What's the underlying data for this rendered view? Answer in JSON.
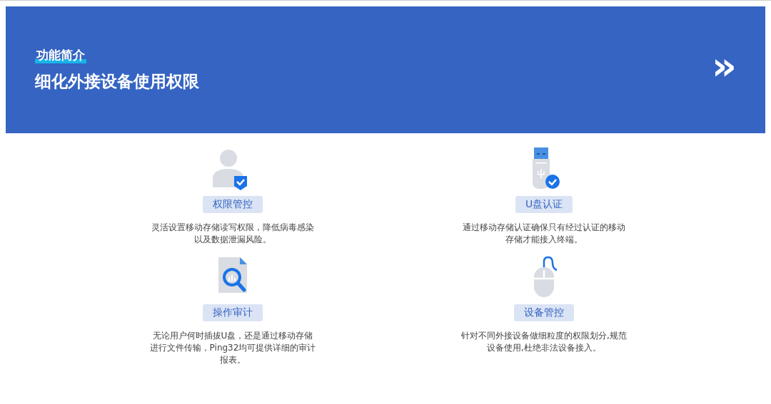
{
  "banner": {
    "eyebrow": "功能简介",
    "title": "细化外接设备使用权限",
    "arrow": "»"
  },
  "features": [
    {
      "kind": "user-shield",
      "label": "权限管控",
      "description": "灵活设置移动存储读写权限，降低病毒感染以及数据泄漏风险。"
    },
    {
      "kind": "usb",
      "label": "U盘认证",
      "description": "通过移动存储认证确保只有经过认证的移动存储才能接入终端。"
    },
    {
      "kind": "document-search",
      "label": "操作审计",
      "description": "无论用户何时插拔U盘，还是通过移动存储进行文件传输，Ping32均可提供详细的审计报表。"
    },
    {
      "kind": "mouse",
      "label": "设备管控",
      "description": "针对不同外接设备做细粒度的权限划分,规范设备使用,杜绝非法设备接入。"
    }
  ]
}
